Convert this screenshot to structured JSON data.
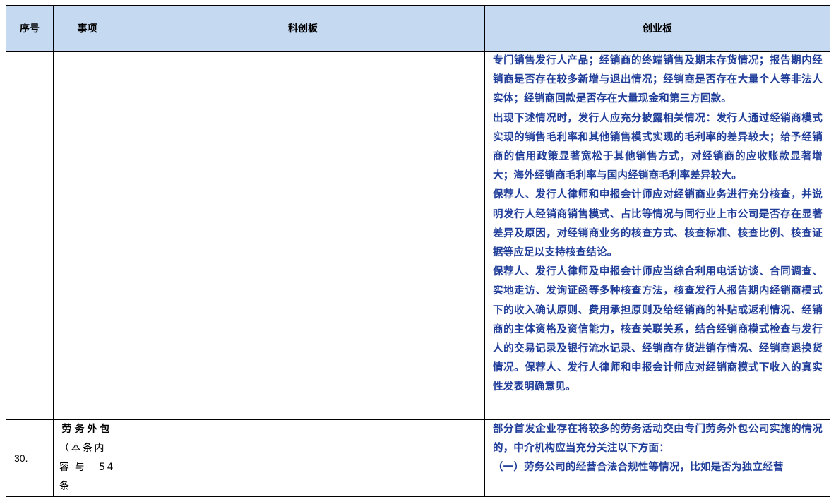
{
  "table": {
    "headers": [
      "序号",
      "事项",
      "科创板",
      "创业板"
    ],
    "rows": [
      {
        "number": "",
        "item_title": "",
        "item_note_lines": [],
        "kechuang": "",
        "chuangye_paragraphs": [
          "专门销售发行人产品；经销商的终端销售及期末存货情况；报告期内经销商是否存在较多新增与退出情况；经销商是否存在大量个人等非法人实体；经销商回款是否存在大量现金和第三方回款。",
          "出现下述情况时，发行人应充分披露相关情况：发行人通过经销商模式实现的销售毛利率和其他销售模式实现的毛利率的差异较大；给予经销商的信用政策显著宽松于其他销售方式，对经销商的应收账款显著增大；海外经销商毛利率与国内经销商毛利率差异较大。",
          "保荐人、发行人律师和申报会计师应对经销商业务进行充分核查，并说明发行人经销商销售模式、占比等情况与同行业上市公司是否存在显著差异及原因，对经销商业务的核查方式、核查标准、核查比例、核查证据等应足以支持核查结论。",
          "保荐人、发行人律师及申报会计师应当综合利用电话访谈、合同调查、实地走访、发询证函等多种核查方法，核查发行人报告期内经销商模式下的收入确认原则、费用承担原则及给经销商的补贴或返利情况、经销商的主体资格及资信能力，核查关联关系，结合经销商模式检查与发行人的交易记录及银行流水记录、经销商存货进销存情况、经销商退换货情况。保荐人、发行人律师和申报会计师应对经销商模式下收入的真实性发表明确意见。"
        ]
      },
      {
        "number": "30.",
        "item_title": "劳务外包",
        "item_note_lines": [
          "（本条内",
          "容与 54 条"
        ],
        "kechuang": "",
        "chuangye_paragraphs": [
          "部分首发企业存在将较多的劳务活动交由专门劳务外包公司实施的情况的，中介机构应当充分关注以下方面：",
          "（一）劳务公司的经营合法合规性等情况，比如是否为独立经营"
        ]
      }
    ]
  }
}
